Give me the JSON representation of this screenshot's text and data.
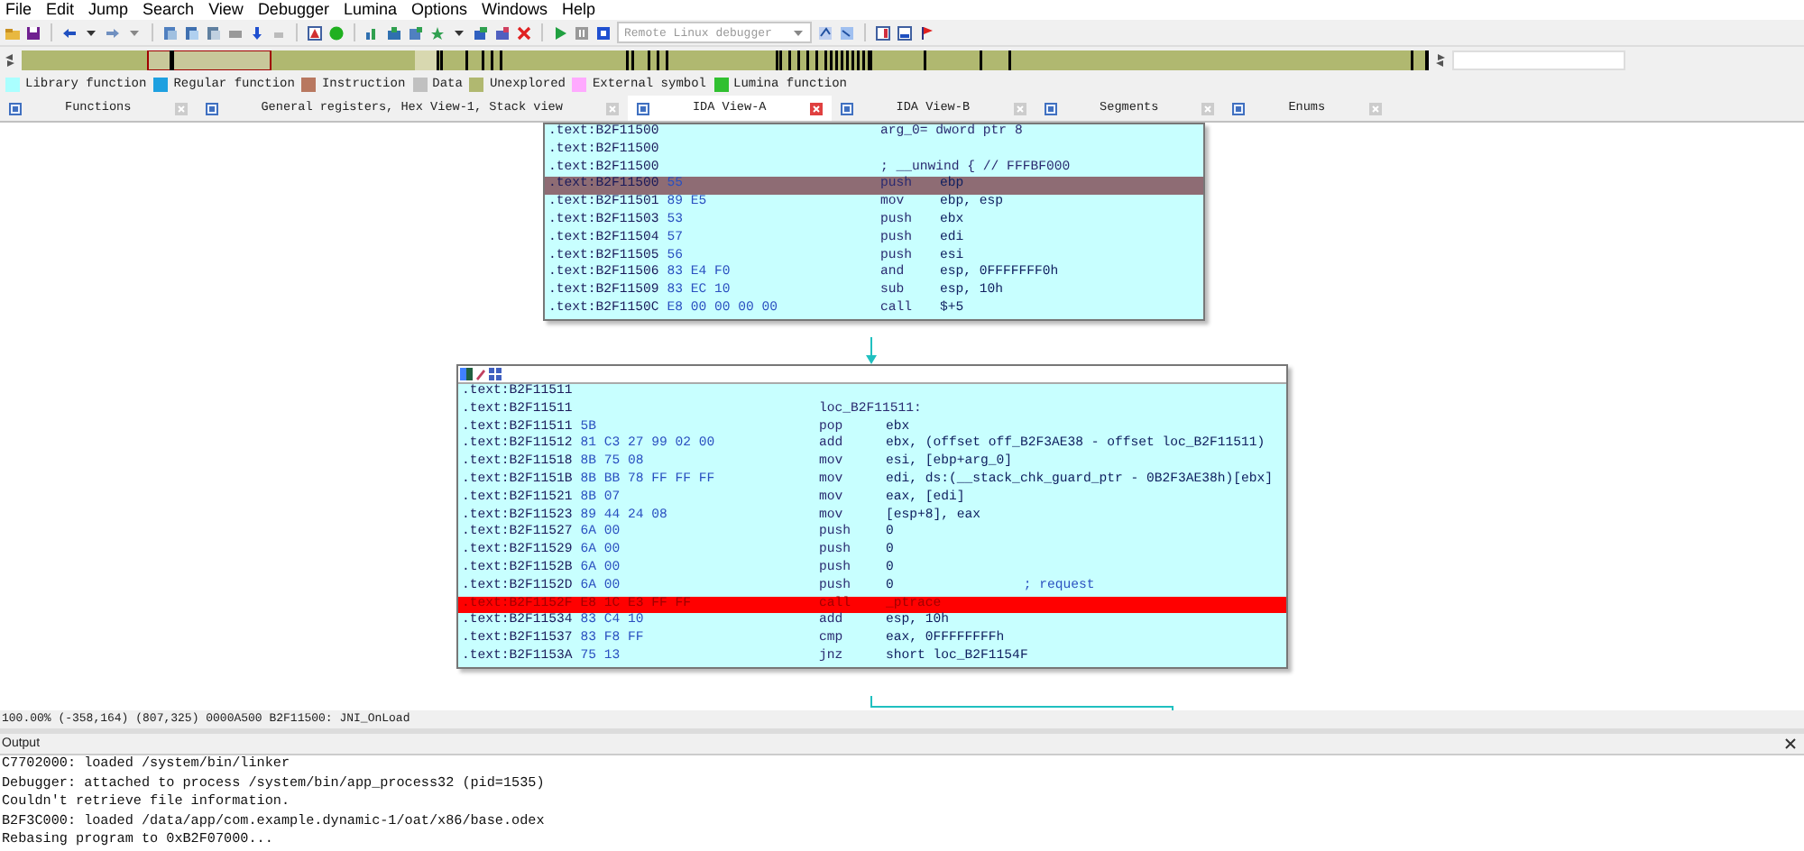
{
  "menu": [
    "File",
    "Edit",
    "Jump",
    "Search",
    "View",
    "Debugger",
    "Lumina",
    "Options",
    "Windows",
    "Help"
  ],
  "debugger_select": {
    "value": "Remote Linux debugger"
  },
  "legend": [
    {
      "label": "Library function",
      "color": "#aaffff"
    },
    {
      "label": "Regular function",
      "color": "#1ea0e0"
    },
    {
      "label": "Instruction",
      "color": "#b87860"
    },
    {
      "label": "Data",
      "color": "#c0c0c0"
    },
    {
      "label": "Unexplored",
      "color": "#b0b870"
    },
    {
      "label": "External symbol",
      "color": "#ffaaff"
    },
    {
      "label": "Lumina function",
      "color": "#30c030"
    }
  ],
  "tabs": [
    {
      "label": "Functions",
      "selected": false
    },
    {
      "label": "General registers, Hex View-1, Stack view",
      "selected": false
    },
    {
      "label": "IDA View-A",
      "selected": true
    },
    {
      "label": "IDA View-B",
      "selected": false
    },
    {
      "label": "Segments",
      "selected": false
    },
    {
      "label": "Enums",
      "selected": false
    }
  ],
  "graph": {
    "nodes": [
      {
        "rows": [
          {
            "kind": "label",
            "addr": ".text:B2F11500",
            "text": "arg_0= dword ptr  8",
            "current": false,
            "breakpoint": false
          },
          {
            "kind": "label",
            "addr": ".text:B2F11500",
            "current": false,
            "breakpoint": false
          },
          {
            "kind": "label",
            "addr": ".text:B2F11500",
            "text": "; __unwind { // FFFBF000",
            "current": false,
            "breakpoint": false
          },
          {
            "kind": "insn",
            "addr": ".text:B2F11500",
            "bytes": "55",
            "mnem": "push",
            "ops": "ebp",
            "current": true,
            "breakpoint": false
          },
          {
            "kind": "insn",
            "addr": ".text:B2F11501",
            "bytes": "89 E5",
            "mnem": "mov",
            "ops": "ebp, esp",
            "current": false,
            "breakpoint": false
          },
          {
            "kind": "insn",
            "addr": ".text:B2F11503",
            "bytes": "53",
            "mnem": "push",
            "ops": "ebx",
            "current": false,
            "breakpoint": false
          },
          {
            "kind": "insn",
            "addr": ".text:B2F11504",
            "bytes": "57",
            "mnem": "push",
            "ops": "edi",
            "current": false,
            "breakpoint": false
          },
          {
            "kind": "insn",
            "addr": ".text:B2F11505",
            "bytes": "56",
            "mnem": "push",
            "ops": "esi",
            "current": false,
            "breakpoint": false
          },
          {
            "kind": "insn",
            "addr": ".text:B2F11506",
            "bytes": "83 E4 F0",
            "mnem": "and",
            "ops": "esp, 0FFFFFFF0h",
            "current": false,
            "breakpoint": false
          },
          {
            "kind": "insn",
            "addr": ".text:B2F11509",
            "bytes": "83 EC 10",
            "mnem": "sub",
            "ops": "esp, 10h",
            "current": false,
            "breakpoint": false
          },
          {
            "kind": "insn",
            "addr": ".text:B2F1150C",
            "bytes": "E8 00 00 00 00",
            "mnem": "call",
            "ops": "$+5",
            "current": false,
            "breakpoint": false
          }
        ]
      },
      {
        "rows": [
          {
            "kind": "label",
            "addr": ".text:B2F11511",
            "current": false,
            "breakpoint": false
          },
          {
            "kind": "label",
            "addr": ".text:B2F11511",
            "text": "loc_B2F11511:",
            "current": false,
            "breakpoint": false
          },
          {
            "kind": "insn",
            "addr": ".text:B2F11511",
            "bytes": "5B",
            "mnem": "pop",
            "ops": "ebx",
            "current": false,
            "breakpoint": false
          },
          {
            "kind": "insn",
            "addr": ".text:B2F11512",
            "bytes": "81 C3 27 99 02 00",
            "mnem": "add",
            "ops": "ebx, (offset off_B2F3AE38 - offset loc_B2F11511)",
            "current": false,
            "breakpoint": false
          },
          {
            "kind": "insn",
            "addr": ".text:B2F11518",
            "bytes": "8B 75 08",
            "mnem": "mov",
            "ops": "esi, [ebp+arg_0]",
            "current": false,
            "breakpoint": false
          },
          {
            "kind": "insn",
            "addr": ".text:B2F1151B",
            "bytes": "8B BB 78 FF FF FF",
            "mnem": "mov",
            "ops": "edi, ds:(__stack_chk_guard_ptr - 0B2F3AE38h)[ebx]",
            "current": false,
            "breakpoint": false
          },
          {
            "kind": "insn",
            "addr": ".text:B2F11521",
            "bytes": "8B 07",
            "mnem": "mov",
            "ops": "eax, [edi]",
            "current": false,
            "breakpoint": false
          },
          {
            "kind": "insn",
            "addr": ".text:B2F11523",
            "bytes": "89 44 24 08",
            "mnem": "mov",
            "ops": "[esp+8], eax",
            "current": false,
            "breakpoint": false
          },
          {
            "kind": "insn",
            "addr": ".text:B2F11527",
            "bytes": "6A 00",
            "mnem": "push",
            "ops": "0",
            "current": false,
            "breakpoint": false
          },
          {
            "kind": "insn",
            "addr": ".text:B2F11529",
            "bytes": "6A 00",
            "mnem": "push",
            "ops": "0",
            "current": false,
            "breakpoint": false
          },
          {
            "kind": "insn",
            "addr": ".text:B2F1152B",
            "bytes": "6A 00",
            "mnem": "push",
            "ops": "0",
            "current": false,
            "breakpoint": false
          },
          {
            "kind": "insn",
            "addr": ".text:B2F1152D",
            "bytes": "6A 00",
            "mnem": "push",
            "ops": "0",
            "comment": "; request",
            "current": false,
            "breakpoint": false
          },
          {
            "kind": "insn",
            "addr": ".text:B2F1152F",
            "bytes": "E8 1C E3 FF FF",
            "mnem": "call",
            "ops": "_ptrace",
            "current": false,
            "breakpoint": true
          },
          {
            "kind": "insn",
            "addr": ".text:B2F11534",
            "bytes": "83 C4 10",
            "mnem": "add",
            "ops": "esp, 10h",
            "current": false,
            "breakpoint": false
          },
          {
            "kind": "insn",
            "addr": ".text:B2F11537",
            "bytes": "83 F8 FF",
            "mnem": "cmp",
            "ops": "eax, 0FFFFFFFFh",
            "current": false,
            "breakpoint": false
          },
          {
            "kind": "insn",
            "addr": ".text:B2F1153A",
            "bytes": "75 13",
            "mnem": "jnz",
            "ops": "short loc_B2F1154F",
            "current": false,
            "breakpoint": false
          }
        ]
      }
    ]
  },
  "status_bar": "100.00% (-358,164) (807,325) 0000A500 B2F11500: JNI_OnLoad",
  "output": {
    "title": "Output",
    "lines": [
      "C7702000: loaded /system/bin/linker",
      "Debugger: attached to process /system/bin/app_process32 (pid=1535)",
      "Couldn't retrieve file information.",
      "B2F3C000: loaded /data/app/com.example.dynamic-1/oat/x86/base.odex",
      "Rebasing program to 0xB2F07000..."
    ]
  }
}
